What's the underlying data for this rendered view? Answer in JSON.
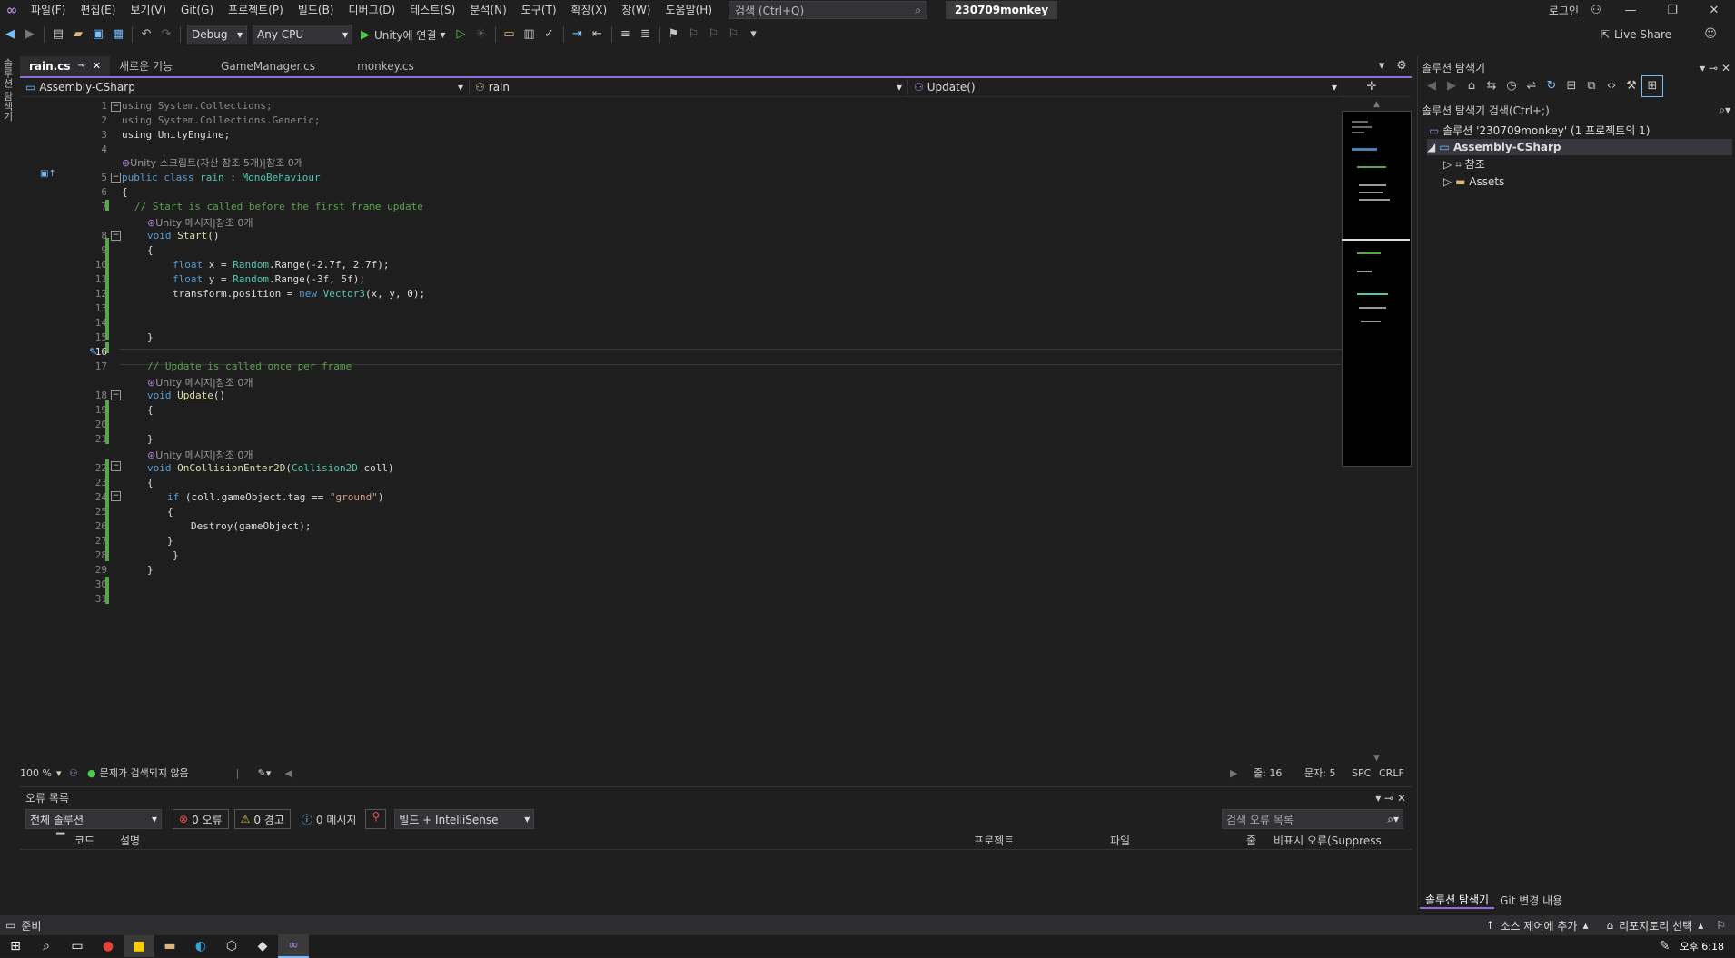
{
  "menubar": {
    "items": [
      "파일(F)",
      "편집(E)",
      "보기(V)",
      "Git(G)",
      "프로젝트(P)",
      "빌드(B)",
      "디버그(D)",
      "테스트(S)",
      "분석(N)",
      "도구(T)",
      "확장(X)",
      "창(W)",
      "도움말(H)"
    ],
    "search_label": "검색 (Ctrl+Q)",
    "project_name": "230709monkey",
    "login": "로그인"
  },
  "toolbar": {
    "config": "Debug",
    "platform": "Any CPU",
    "run_label": "Unity에 연결",
    "live_share": "Live Share"
  },
  "left_strip": {
    "label": "솔루션 탐색기"
  },
  "tabs": [
    {
      "label": "rain.cs",
      "active": true
    },
    {
      "label": "새로운 기능",
      "active": false
    },
    {
      "label": "GameManager.cs",
      "active": false
    },
    {
      "label": "monkey.cs",
      "active": false
    }
  ],
  "navbar": {
    "project": "Assembly-CSharp",
    "class": "rain",
    "member": "Update()"
  },
  "code": {
    "line_numbers": [
      "1",
      "2",
      "3",
      "4",
      "5",
      "6",
      "7",
      "8",
      "9",
      "10",
      "11",
      "12",
      "13",
      "14",
      "15",
      "16",
      "17",
      "18",
      "19",
      "20",
      "21",
      "22",
      "23",
      "24",
      "25",
      "26",
      "27",
      "28",
      "29",
      "30",
      "31"
    ],
    "current_line": "16",
    "lens_class": "Unity 스크립트(자산 참조 5개)|참조 0개",
    "lens_method": "Unity 메시지|참조 0개",
    "lines": {
      "l1": "using System.Collections;",
      "l2": "using System.Collections.Generic;",
      "l3": "using UnityEngine;",
      "l5a": "public class ",
      "l5b": "rain",
      "l5c": " : ",
      "l5d": "MonoBehaviour",
      "l6": "{",
      "l7": "// Start is called before the first frame update",
      "l8a": "void ",
      "l8b": "Start",
      "l8c": "()",
      "l9": "{",
      "l10a": "float",
      "l10b": " x = ",
      "l10c": "Random",
      "l10d": ".Range(-2.7f, 2.7f);",
      "l11a": "float",
      "l11b": " y = ",
      "l11c": "Random",
      "l11d": ".Range(-3f, 5f);",
      "l12a": "transform.position = ",
      "l12b": "new",
      "l12c": " ",
      "l12d": "Vector3",
      "l12e": "(x, y, 0);",
      "l15": "}",
      "l17": "// Update is called once per frame",
      "l18a": "void ",
      "l18b": "Update",
      "l18c": "()",
      "l19": "{",
      "l21": "}",
      "l22a": "void ",
      "l22b": "OnCollisionEnter2D",
      "l22c": "(",
      "l22d": "Collision2D",
      "l22e": " coll)",
      "l23": "{",
      "l24a": "if",
      "l24b": " (coll.gameObject.tag == ",
      "l24c": "\"ground\"",
      "l24d": ")",
      "l25": "{",
      "l26": "Destroy(gameObject);",
      "l27": "}",
      "l28": "}",
      "l29": "}"
    }
  },
  "editor_status": {
    "zoom": "100 %",
    "issues": "문제가 검색되지 않음",
    "line": "줄: 16",
    "col": "문자: 5",
    "spc": "SPC",
    "crlf": "CRLF"
  },
  "error_list": {
    "title": "오류 목록",
    "scope": "전체 솔루션",
    "errors": "0 오류",
    "warnings": "0 경고",
    "messages": "0 메시지",
    "build_filter": "빌드 + IntelliSense",
    "search": "검색 오류 목록",
    "columns": {
      "code": "코드",
      "desc": "설명",
      "project": "프로젝트",
      "file": "파일",
      "line": "줄",
      "suppress": "비표시 오류(Suppress"
    }
  },
  "solution_explorer": {
    "title": "솔루션 탐색기",
    "search": "솔루션 탐색기 검색(Ctrl+;)",
    "solution": "솔루션 '230709monkey' (1 프로젝트의 1)",
    "project": "Assembly-CSharp",
    "refs": "참조",
    "assets": "Assets",
    "bottom_tabs": [
      "솔루션 탐색기",
      "Git 변경 내용"
    ]
  },
  "statusbar": {
    "ready": "준비",
    "source_control": "소스 제어에 추가",
    "repo": "리포지토리 선택"
  },
  "taskbar": {
    "time": "오후 6:18"
  },
  "colors": {
    "accent": "#8f6fd6",
    "keyword": "#569cd6",
    "type": "#4ec9b0",
    "comment": "#57a64a",
    "string": "#d69d85"
  }
}
